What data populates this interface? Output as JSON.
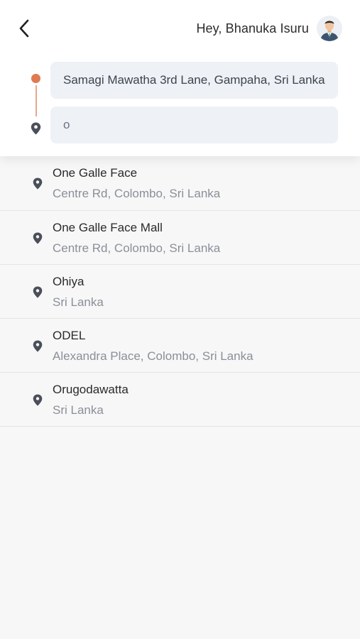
{
  "header": {
    "greeting": "Hey, Bhanuka Isuru"
  },
  "route": {
    "pickup_value": "Samagi Mawatha 3rd Lane, Gampaha, Sri Lanka",
    "destination_value": "o"
  },
  "results": [
    {
      "name": "One Galle Face",
      "address": "Centre Rd, Colombo, Sri Lanka"
    },
    {
      "name": "One Galle Face Mall",
      "address": "Centre Rd, Colombo, Sri Lanka"
    },
    {
      "name": "Ohiya",
      "address": "Sri Lanka"
    },
    {
      "name": "ODEL",
      "address": "Alexandra Place, Colombo, Sri Lanka"
    },
    {
      "name": "Orugodawatta",
      "address": "Sri Lanka"
    }
  ],
  "colors": {
    "origin_accent": "#e07a53",
    "pin": "#4a4f5a",
    "field_bg": "#eef1f5"
  },
  "icons": {
    "back": "chevron-left-icon",
    "avatar": "user-avatar-icon",
    "origin": "origin-dot-icon",
    "destination": "map-pin-icon"
  }
}
